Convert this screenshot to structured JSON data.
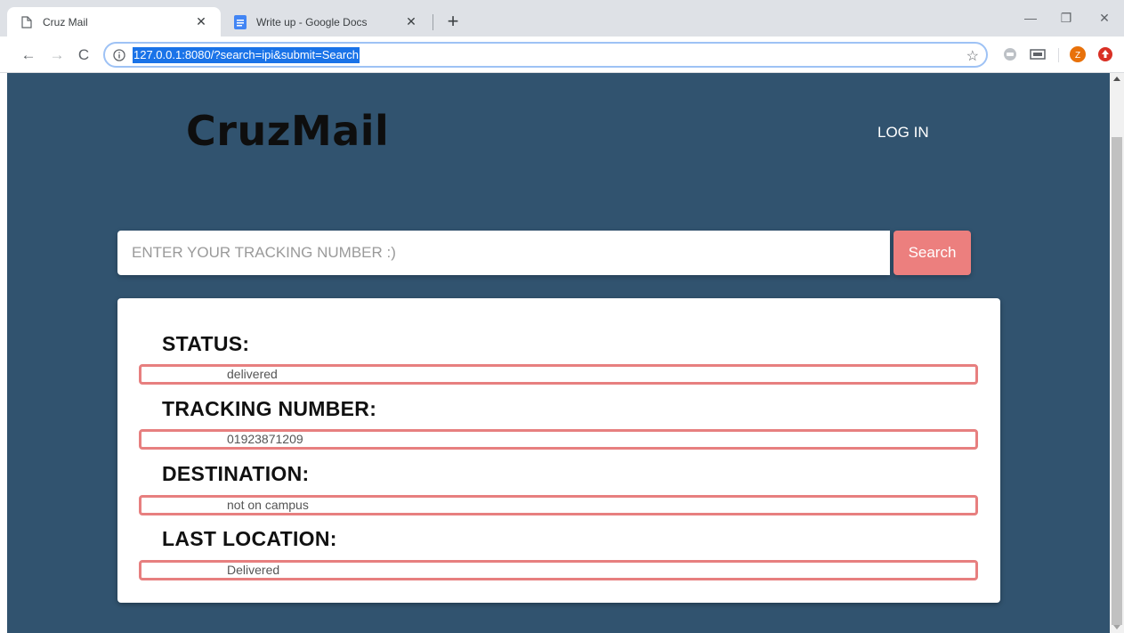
{
  "browser": {
    "tabs": [
      {
        "title": "Cruz Mail",
        "icon": "page-icon"
      },
      {
        "title": "Write up - Google Docs",
        "icon": "google-docs-icon"
      }
    ],
    "new_tab_symbol": "+",
    "address": "127.0.0.1:8080/?search=ipi&submit=Search",
    "window_controls": {
      "minimize": "—",
      "restore": "❐",
      "close": "✕"
    },
    "profile_initial": "Z",
    "accent_color": "#1a73e8"
  },
  "site": {
    "brand": "CruzMail",
    "nav_login": "LOG IN",
    "background_color": "#31536f",
    "accent_color": "#ec7f7e"
  },
  "search": {
    "placeholder": "ENTER YOUR TRACKING NUMBER :)",
    "button_label": "Search"
  },
  "result": {
    "fields": [
      {
        "label": "STATUS:",
        "value": "delivered"
      },
      {
        "label": "TRACKING NUMBER:",
        "value": "01923871209"
      },
      {
        "label": "DESTINATION:",
        "value": "not on campus"
      },
      {
        "label": "LAST LOCATION:",
        "value": "Delivered"
      }
    ]
  }
}
